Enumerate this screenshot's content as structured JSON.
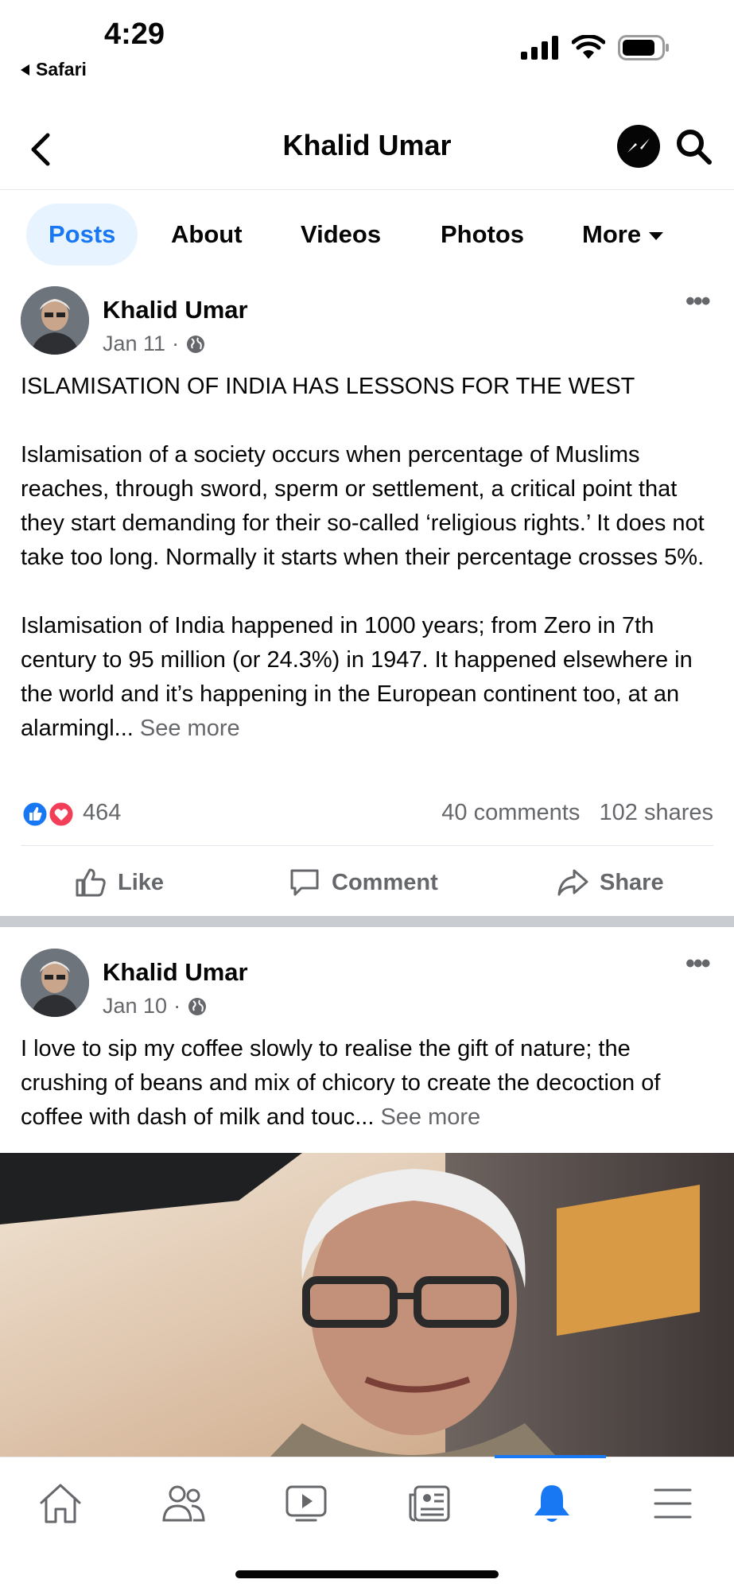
{
  "status_bar": {
    "time": "4:29",
    "back_app": "Safari"
  },
  "header": {
    "title": "Khalid Umar"
  },
  "tabs": [
    {
      "label": "Posts",
      "active": true
    },
    {
      "label": "About"
    },
    {
      "label": "Videos"
    },
    {
      "label": "Photos"
    },
    {
      "label": "More"
    }
  ],
  "posts": [
    {
      "author": "Khalid Umar",
      "date": "Jan 11",
      "dot": "·",
      "text": "ISLAMISATION OF INDIA HAS LESSONS FOR THE WEST\n\nIslamisation of a society occurs when percentage of Muslims reaches, through sword, sperm or settlement, a critical point that they start demanding for their so-called ‘religious rights.’ It does not take too long. Normally it starts when their percentage crosses 5%.\n\nIslamisation of India happened in 1000 years; from Zero in 7th century to 95 million (or 24.3%) in 1947. It happened elsewhere in the world and it’s happening in the European continent too, at an alarmingl...",
      "see_more": "See more",
      "reaction_count": "464",
      "comments": "40 comments",
      "shares": "102 shares",
      "actions": {
        "like": "Like",
        "comment": "Comment",
        "share": "Share"
      }
    },
    {
      "author": "Khalid Umar",
      "date": "Jan 10",
      "dot": "·",
      "text": "I love to sip my coffee slowly to realise the gift of nature; the crushing of beans and mix of chicory to create the decoction of coffee with dash of milk and touc...",
      "see_more": "See more"
    }
  ],
  "colors": {
    "accent": "#1877f2",
    "secondary_text": "#65676b",
    "divider": "#e4e6eb",
    "love": "#f33e58"
  },
  "icons": [
    "chevron-left-icon",
    "messenger-icon",
    "search-icon",
    "globe-icon",
    "more-dots-icon",
    "like-icon",
    "comment-icon",
    "share-icon",
    "home-icon",
    "friends-icon",
    "watch-icon",
    "news-icon",
    "bell-icon",
    "menu-icon"
  ]
}
